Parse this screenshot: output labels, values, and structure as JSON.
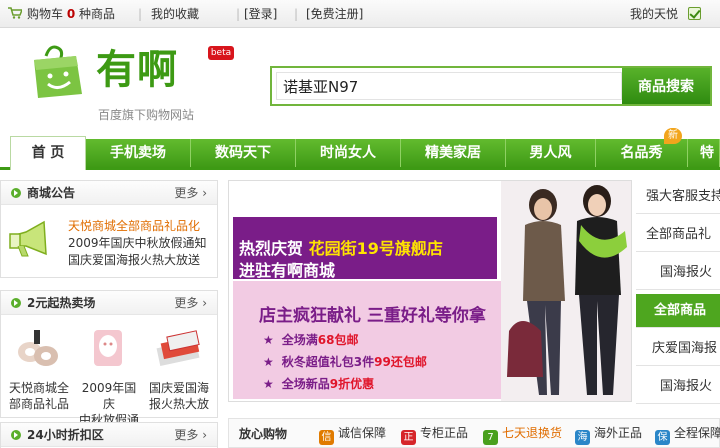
{
  "topbar": {
    "cart_label": "购物车",
    "cart_count": "0",
    "cart_unit": "种商品",
    "favorites": "我的收藏",
    "login": "[登录]",
    "register": "[免费注册]",
    "my_account": "我的天悦"
  },
  "header": {
    "logo_text": "有啊",
    "beta": "beta",
    "tagline": "百度旗下购物网站"
  },
  "search": {
    "value": "诺基亚N97",
    "button": "商品搜索"
  },
  "nav": {
    "tabs": [
      "首 页",
      "手机卖场",
      "数码天下",
      "时尚女人",
      "精美家居",
      "男人风",
      "名品秀",
      "特"
    ],
    "new_badge": "新"
  },
  "notice_panel": {
    "title": "商城公告",
    "more": "更多",
    "lines": [
      "天悦商城全部商品礼品化",
      "2009年国庆中秋放假通知",
      "国庆爱国海报火热大放送"
    ]
  },
  "hot_panel": {
    "title": "2元起热卖场",
    "more": "更多",
    "products": [
      {
        "line1": "天悦商城全",
        "line2": "部商品礼品"
      },
      {
        "line1": "2009年国庆",
        "line2": "中秋放假通"
      },
      {
        "line1": "国庆爱国海",
        "line2": "报火热大放"
      }
    ]
  },
  "discount_panel": {
    "title": "24小时折扣区",
    "more": "更多"
  },
  "banner": {
    "line1_a": "热烈庆贺",
    "line1_b": "花园街19号旗舰店",
    "line2": "进驻有啊商城",
    "slogan": "店主疯狂献礼 三重好礼等你拿",
    "bullets": [
      {
        "a": "全场满",
        "b": "68包邮",
        "c": ""
      },
      {
        "a": "秋冬超值礼包3件",
        "b": "99还包邮",
        "c": ""
      },
      {
        "a": "全场新品",
        "b": "9折优惠",
        "c": ""
      }
    ]
  },
  "assurance": {
    "title": "放心购物",
    "items": [
      {
        "icon": "信",
        "label": "诚信保障",
        "color": "#e07b00"
      },
      {
        "icon": "正",
        "label": "专柜正品",
        "color": "#d6262a"
      },
      {
        "icon": "7",
        "label": "七天退换货",
        "color": "#49a01e"
      },
      {
        "icon": "海",
        "label": "海外正品",
        "color": "#2a86c8"
      },
      {
        "icon": "保",
        "label": "全程保障",
        "color": "#2a86c8"
      }
    ]
  },
  "right_menu": {
    "items": [
      "强大客服支持",
      "全部商品礼",
      "国海报火",
      "全部商品",
      "庆爱国海报",
      "国海报火"
    ]
  },
  "colors": {
    "brand_green": "#3d9a14",
    "accent_purple": "#7a1d88",
    "highlight_orange": "#e06d00"
  }
}
